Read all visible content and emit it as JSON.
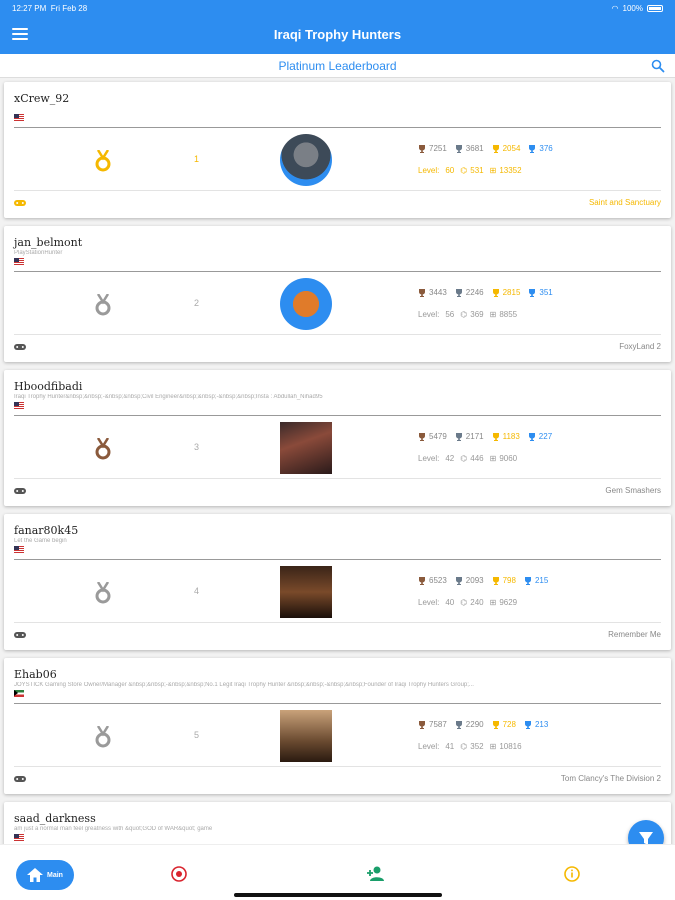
{
  "status": {
    "time": "12:27 PM",
    "date": "Fri Feb 28",
    "battery": "100%"
  },
  "header": {
    "title": "Iraqi Trophy Hunters"
  },
  "subheader": {
    "title": "Platinum Leaderboard"
  },
  "colors": {
    "primary": "#2d8df0",
    "gold": "#f5b800",
    "silver": "#9a9a9a",
    "bronze": "#8a5a3c",
    "platinum": "#2d8df0"
  },
  "cards": [
    {
      "username": "xCrew_92",
      "subtitle": "",
      "flag": "us",
      "rank": "1",
      "medal": "gold",
      "bronze": "7251",
      "silver": "3681",
      "gold": "2054",
      "platinum": "376",
      "level_label": "Level:",
      "level": "60",
      "games": "531",
      "completion": "13352",
      "game": "Saint and Sanctuary",
      "highlight": true
    },
    {
      "username": "jan_belmont",
      "subtitle": "PlayStationHunter",
      "flag": "us",
      "rank": "2",
      "medal": "silver",
      "bronze": "3443",
      "silver": "2246",
      "gold": "2815",
      "platinum": "351",
      "level_label": "Level:",
      "level": "56",
      "games": "369",
      "completion": "8855",
      "game": "FoxyLand 2",
      "highlight": false
    },
    {
      "username": "Hboodfibadi",
      "subtitle": "Iraqi Trophy Hunter&nbsp;&nbsp;-&nbsp;&nbsp;Civil Engineer&nbsp;&nbsp;-&nbsp;&nbsp;Insta : Abdullah_Nihad95",
      "flag": "us",
      "rank": "3",
      "medal": "bronze",
      "bronze": "5479",
      "silver": "2171",
      "gold": "1183",
      "platinum": "227",
      "level_label": "Level:",
      "level": "42",
      "games": "446",
      "completion": "9060",
      "game": "Gem Smashers",
      "highlight": false
    },
    {
      "username": "fanar80k45",
      "subtitle": "Let the Game begin",
      "flag": "us",
      "rank": "4",
      "medal": "silver",
      "bronze": "6523",
      "silver": "2093",
      "gold": "798",
      "platinum": "215",
      "level_label": "Level:",
      "level": "40",
      "games": "240",
      "completion": "9629",
      "game": "Remember Me",
      "highlight": false
    },
    {
      "username": "Ehab06",
      "subtitle": "JOYSTICK Gaming Store Owner/Manager &nbsp;&nbsp;-&nbsp;&nbsp;No.1 Legit Iraqi Trophy Hunter &nbsp;&nbsp;-&nbsp;&nbsp;Founder of Iraqi Trophy Hunters Group;...",
      "flag": "kw",
      "rank": "5",
      "medal": "silver",
      "bronze": "7587",
      "silver": "2290",
      "gold": "728",
      "platinum": "213",
      "level_label": "Level:",
      "level": "41",
      "games": "352",
      "completion": "10816",
      "game": "Tom Clancy's The Division 2",
      "highlight": false
    },
    {
      "username": "saad_darkness",
      "subtitle": "am just a normal man feel greatness with &quot;GOD of WAR&quot; game",
      "flag": "us"
    }
  ],
  "bottom_nav": {
    "main_label": "Main"
  }
}
